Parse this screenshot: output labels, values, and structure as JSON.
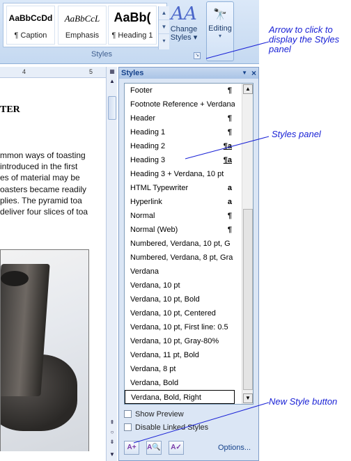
{
  "ribbon": {
    "gallery": [
      {
        "sample": "AaBbCcDd",
        "label": "¶ Caption"
      },
      {
        "sample": "AaBbCcL",
        "label": "Emphasis"
      },
      {
        "sample": "AaBb(",
        "label": "¶ Heading 1"
      }
    ],
    "change_styles": {
      "icon": "AA",
      "label1": "Change",
      "label2": "Styles ▾"
    },
    "group_label": "Styles",
    "editing_label": "Editing",
    "editing_chevron": "▾"
  },
  "ruler": {
    "tick4": "4",
    "tick5": "5"
  },
  "document": {
    "heading": "TER",
    "lines": [
      "mmon ways of toasting",
      "introduced in the first",
      "es of material may be",
      "oasters became readily",
      "plies.  The pyramid toa",
      "deliver  four slices of toa"
    ]
  },
  "styles_pane": {
    "title": "Styles",
    "items": [
      {
        "name": "Footer",
        "mark": "¶"
      },
      {
        "name": "Footnote Reference + Verdana",
        "mark": ""
      },
      {
        "name": "Header",
        "mark": "¶"
      },
      {
        "name": "Heading 1",
        "mark": "¶"
      },
      {
        "name": "Heading 2",
        "mark": "¶a"
      },
      {
        "name": "Heading 3",
        "mark": "¶a"
      },
      {
        "name": "Heading 3 + Verdana, 10 pt",
        "mark": ""
      },
      {
        "name": "HTML Typewriter",
        "mark": "a"
      },
      {
        "name": "Hyperlink",
        "mark": "a"
      },
      {
        "name": "Normal",
        "mark": "¶"
      },
      {
        "name": "Normal (Web)",
        "mark": "¶"
      },
      {
        "name": "Numbered, Verdana, 10 pt, G",
        "mark": ""
      },
      {
        "name": "Numbered, Verdana, 8 pt, Gra",
        "mark": ""
      },
      {
        "name": "Verdana",
        "mark": ""
      },
      {
        "name": "Verdana, 10 pt",
        "mark": ""
      },
      {
        "name": "Verdana, 10 pt, Bold",
        "mark": ""
      },
      {
        "name": "Verdana, 10 pt, Centered",
        "mark": ""
      },
      {
        "name": "Verdana, 10 pt, First line:  0.5",
        "mark": ""
      },
      {
        "name": "Verdana, 10 pt, Gray-80%",
        "mark": ""
      },
      {
        "name": "Verdana, 11 pt, Bold",
        "mark": ""
      },
      {
        "name": "Verdana, 8 pt",
        "mark": ""
      },
      {
        "name": "Verdana, Bold",
        "mark": ""
      },
      {
        "name": "Verdana, Bold, Right",
        "mark": ""
      }
    ],
    "show_preview": "Show Preview",
    "disable_linked": "Disable Linked Styles",
    "options": "Options..."
  },
  "annotations": {
    "arrow_note": "Arrow to click to display the Styles panel",
    "styles_panel_note": "Styles panel",
    "new_style_note": "New Style button"
  },
  "colors": {
    "annotation": "#1a22d6",
    "ribbon": "#c5d9f1",
    "pane": "#dbe6f5"
  }
}
